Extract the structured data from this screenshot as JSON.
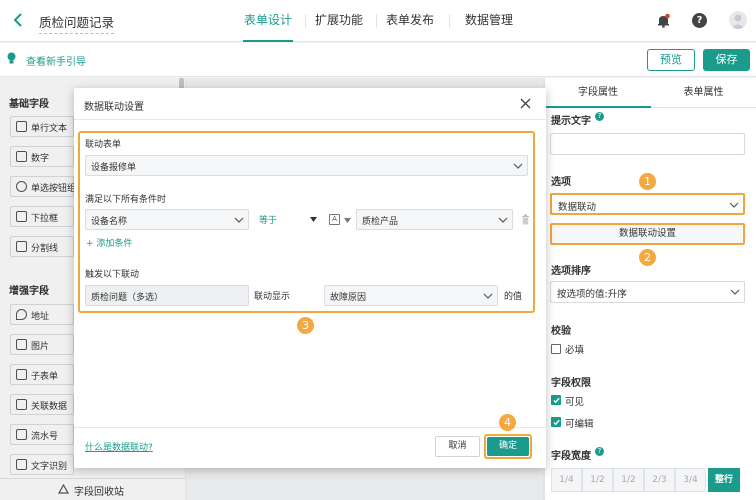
{
  "header": {
    "title": "质检问题记录",
    "tabs": [
      {
        "label": "表单设计",
        "active": true
      },
      {
        "label": "扩展功能",
        "active": false
      },
      {
        "label": "表单发布",
        "active": false
      },
      {
        "label": "数据管理",
        "active": false
      }
    ]
  },
  "subbar": {
    "guide_link": "查看新手引导",
    "preview_label": "预览",
    "save_label": "保存"
  },
  "left_panel": {
    "basic_title": "基础字段",
    "basic_fields": [
      "单行文本",
      "数字",
      "单选按钮组",
      "下拉框",
      "分割线"
    ],
    "enhanced_title": "增强字段",
    "enhanced_fields": [
      "地址",
      "图片",
      "子表单",
      "关联数据",
      "流水号",
      "文字识别"
    ],
    "recycle_label": "字段回收站"
  },
  "modal": {
    "title": "数据联动设置",
    "linked_form_label": "联动表单",
    "linked_form_value": "设备报修单",
    "condition_label": "满足以下所有条件时",
    "condition_field": "设备名称",
    "condition_operator": "等于",
    "condition_value": "质检产品",
    "add_condition": "添加条件",
    "trigger_label": "触发以下联动",
    "trigger_field": "质检问题（多选）",
    "trigger_middle": "联动显示",
    "trigger_target": "故障原因",
    "trigger_suffix": "的值",
    "help_link": "什么是数据联动?",
    "cancel_label": "取消",
    "confirm_label": "确定"
  },
  "right_panel": {
    "tabs": [
      {
        "label": "字段属性",
        "active": true
      },
      {
        "label": "表单属性",
        "active": false
      }
    ],
    "hint_label": "提示文字",
    "options_label": "选项",
    "options_select": "数据联动",
    "linkage_button": "数据联动设置",
    "sort_label": "选项排序",
    "sort_value": "按选项的值:升序",
    "validation_label": "校验",
    "required_label": "必填",
    "permission_label": "字段权限",
    "visible_label": "可见",
    "visible_checked": true,
    "editable_label": "可编辑",
    "editable_checked": true,
    "width_label": "字段宽度",
    "width_options": [
      "1/4",
      "1/2",
      "1/2",
      "2/3",
      "3/4",
      "整行"
    ],
    "width_selected": "整行"
  },
  "annotations": [
    "1",
    "2",
    "3",
    "4"
  ],
  "colors": {
    "accent": "#1a9b8c",
    "highlight": "#f0a73e",
    "badge": "#f3a93f"
  }
}
